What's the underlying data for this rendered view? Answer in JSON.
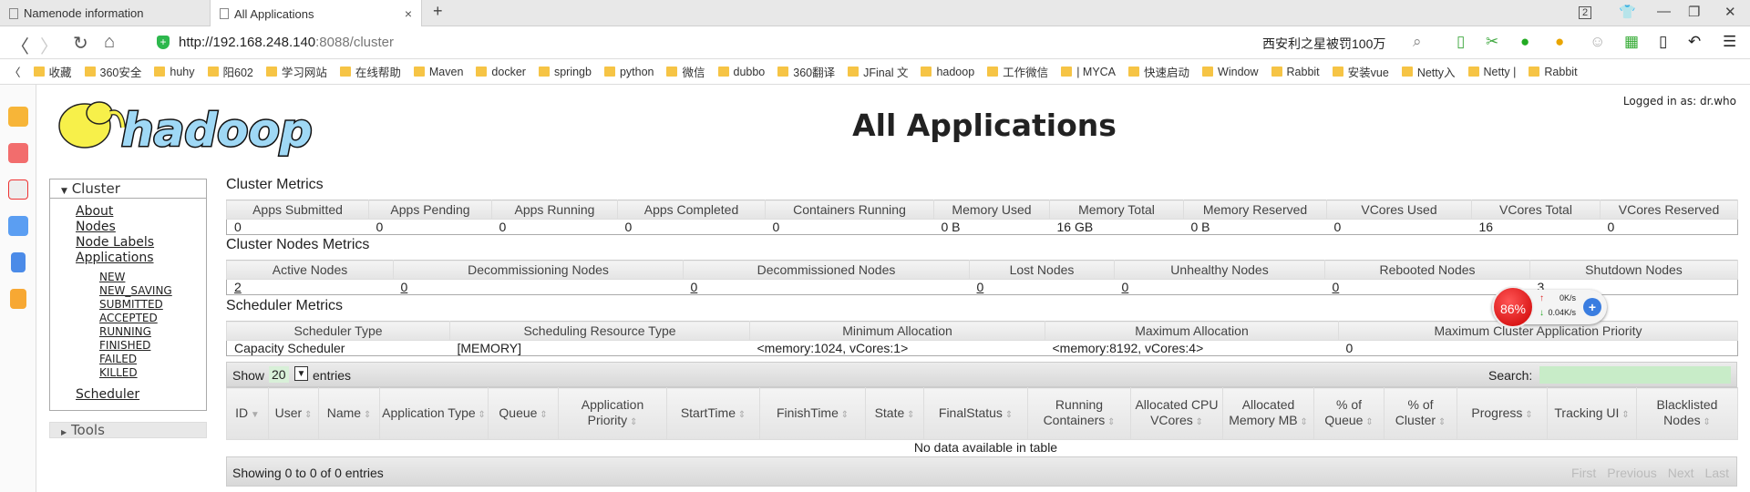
{
  "browser": {
    "tabs": [
      {
        "label": "Namenode information"
      },
      {
        "label": "All Applications"
      }
    ],
    "url_host": "http://192.168.248.140",
    "url_rest": ":8088/cluster",
    "search_text": "西安利之星被罚100万",
    "tab_count": "2",
    "bookmarks": [
      "收藏",
      "360安全",
      "huhy",
      "阳602",
      "学习网站",
      "在线帮助",
      "Maven",
      "docker",
      "springb",
      "python",
      "微信",
      "dubbo",
      "360翻译",
      "JFinal 文",
      "hadoop",
      "工作微信",
      "| MYCA",
      "快速启动",
      "Window",
      "Rabbit",
      "安装vue",
      "Netty入",
      "Netty |",
      "Rabbit"
    ]
  },
  "header": {
    "logo_text": "hadoop",
    "title": "All Applications",
    "login": "Logged in as: dr.who"
  },
  "nav": {
    "cluster_label": "Cluster",
    "links": [
      "About",
      "Nodes",
      "Node Labels",
      "Applications"
    ],
    "app_states": [
      "NEW",
      "NEW_SAVING",
      "SUBMITTED",
      "ACCEPTED",
      "RUNNING",
      "FINISHED",
      "FAILED",
      "KILLED"
    ],
    "scheduler": "Scheduler",
    "tools_label": "Tools"
  },
  "cluster_metrics": {
    "title": "Cluster Metrics",
    "headers": [
      "Apps Submitted",
      "Apps Pending",
      "Apps Running",
      "Apps Completed",
      "Containers Running",
      "Memory Used",
      "Memory Total",
      "Memory Reserved",
      "VCores Used",
      "VCores Total",
      "VCores Reserved"
    ],
    "values": [
      "0",
      "0",
      "0",
      "0",
      "0",
      "0 B",
      "16 GB",
      "0 B",
      "0",
      "16",
      "0"
    ]
  },
  "node_metrics": {
    "title": "Cluster Nodes Metrics",
    "headers": [
      "Active Nodes",
      "Decommissioning Nodes",
      "Decommissioned Nodes",
      "Lost Nodes",
      "Unhealthy Nodes",
      "Rebooted Nodes",
      "Shutdown Nodes"
    ],
    "values": [
      "2",
      "0",
      "0",
      "0",
      "0",
      "0",
      "3"
    ]
  },
  "scheduler_metrics": {
    "title": "Scheduler Metrics",
    "headers": [
      "Scheduler Type",
      "Scheduling Resource Type",
      "Minimum Allocation",
      "Maximum Allocation",
      "Maximum Cluster Application Priority"
    ],
    "values": [
      "Capacity Scheduler",
      "[MEMORY]",
      "<memory:1024, vCores:1>",
      "<memory:8192, vCores:4>",
      "0"
    ]
  },
  "apps_table": {
    "show_label": "Show",
    "entries_value": "20",
    "entries_label": "entries",
    "search_label": "Search:",
    "search_value": "",
    "columns": [
      "ID",
      "User",
      "Name",
      "Application Type",
      "Queue",
      "Application Priority",
      "StartTime",
      "FinishTime",
      "State",
      "FinalStatus",
      "Running Containers",
      "Allocated CPU VCores",
      "Allocated Memory MB",
      "% of Queue",
      "% of Cluster",
      "Progress",
      "Tracking UI",
      "Blacklisted Nodes"
    ],
    "empty": "No data available in table",
    "info": "Showing 0 to 0 of 0 entries",
    "pager": [
      "First",
      "Previous",
      "Next",
      "Last"
    ]
  },
  "widget": {
    "percent": "86%",
    "up": "0K/s",
    "down": "0.04K/s"
  }
}
